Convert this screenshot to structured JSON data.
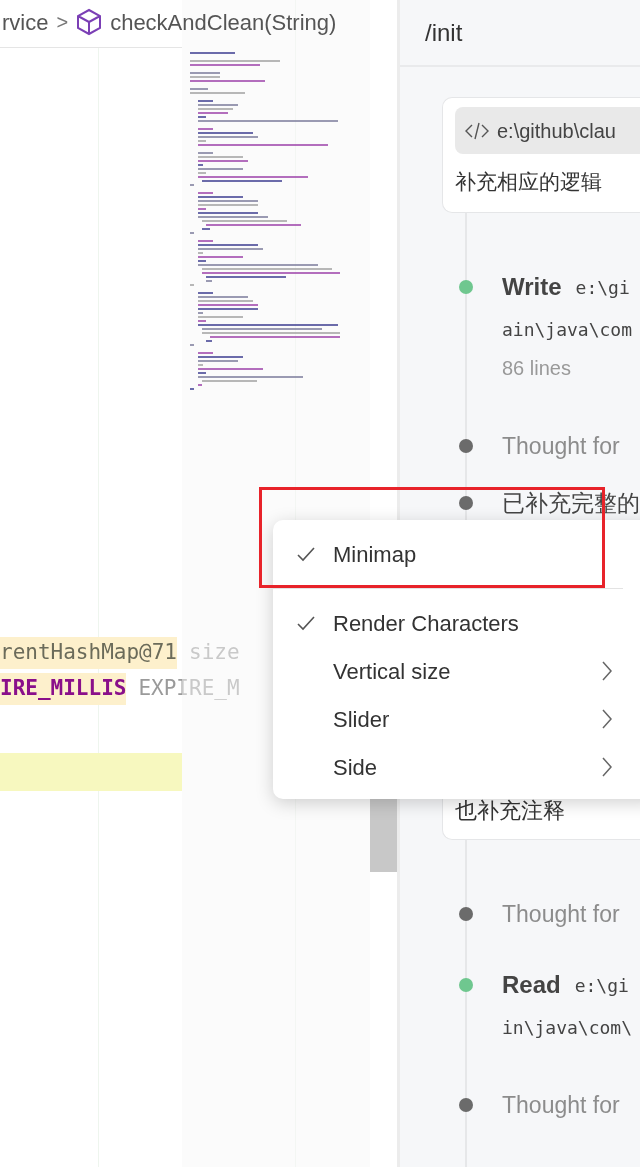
{
  "editor": {
    "breadcrumb": {
      "parent": "rvice",
      "separator": ">",
      "symbol": "checkAndClean(String)"
    },
    "code_lines": [
      {
        "text": "rentHashMap@71",
        "hint": " size",
        "highlighted": true
      },
      {
        "text": "IRE_MILLIS",
        "hint": "EXPIRE_M",
        "highlighted": true
      }
    ],
    "current_line": true
  },
  "panel": {
    "title": "/init",
    "prompt_card": {
      "chip": "e:\\github\\clau",
      "text": "补充相应的逻辑"
    },
    "timeline": [
      {
        "kind": "tool",
        "name": "Write",
        "path": "e:\\gi",
        "path_cont": "ain\\java\\com",
        "meta": "86 lines"
      },
      {
        "kind": "thought",
        "text": "Thought for"
      },
      {
        "kind": "message",
        "text": "已补充完整的"
      },
      {
        "kind": "card",
        "text": "也补充注释"
      },
      {
        "kind": "thought",
        "text": "Thought for"
      },
      {
        "kind": "tool",
        "name": "Read",
        "path": "e:\\gi",
        "path_cont": "in\\java\\com\\"
      },
      {
        "kind": "thought",
        "text": "Thought for"
      }
    ]
  },
  "context_menu": {
    "groups": [
      [
        {
          "label": "Minimap",
          "checked": true,
          "submenu": false
        }
      ],
      [
        {
          "label": "Render Characters",
          "checked": true,
          "submenu": false
        },
        {
          "label": "Vertical size",
          "checked": false,
          "submenu": true
        },
        {
          "label": "Slider",
          "checked": false,
          "submenu": true
        },
        {
          "label": "Side",
          "checked": false,
          "submenu": true
        }
      ]
    ]
  }
}
